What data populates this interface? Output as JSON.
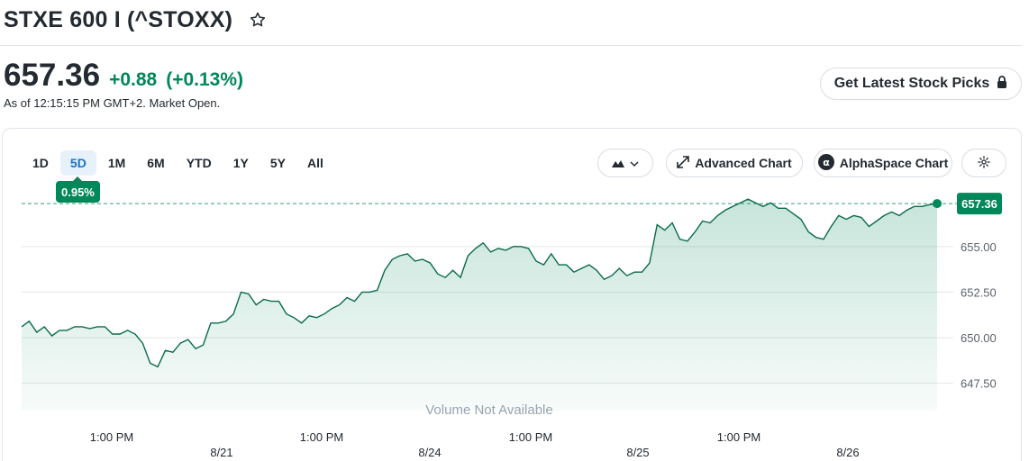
{
  "header": {
    "title": "STXE 600 I (^STOXX)"
  },
  "quote": {
    "price": "657.36",
    "change": "+0.88",
    "change_pct": "(+0.13%)",
    "as_of": "As of 12:15:15 PM GMT+2. Market Open."
  },
  "picks_button": {
    "label": "Get Latest Stock Picks"
  },
  "range_tabs": [
    {
      "label": "1D"
    },
    {
      "label": "5D"
    },
    {
      "label": "1M"
    },
    {
      "label": "6M"
    },
    {
      "label": "YTD"
    },
    {
      "label": "1Y"
    },
    {
      "label": "5Y"
    },
    {
      "label": "All"
    }
  ],
  "active_range": "5D",
  "range_change_badge": "0.95%",
  "toolbar": {
    "advanced_chart": "Advanced Chart",
    "alphaspace_chart": "AlphaSpace Chart"
  },
  "colors": {
    "positive": "#00875a",
    "active_tab": "#1a73c6",
    "text": "#232a31"
  },
  "chart_data": {
    "type": "area",
    "title": "",
    "ylim": [
      646.0,
      658.5
    ],
    "y_ticks": [
      647.5,
      650.0,
      652.5,
      655.0
    ],
    "y_tick_labels": [
      "647.50",
      "650.00",
      "652.50",
      "655.00"
    ],
    "x_time_labels": [
      "1:00 PM",
      "1:00 PM",
      "1:00 PM",
      "1:00 PM"
    ],
    "x_date_labels": [
      "8/21",
      "8/24",
      "8/25",
      "8/26"
    ],
    "last_price": 657.36,
    "last_price_label": "657.36",
    "previous_close_line": 657.36,
    "volume_note": "Volume Not Available",
    "series": [
      {
        "values": [
          650.6,
          650.9,
          650.3,
          650.6,
          650.1,
          650.4,
          650.4,
          650.6,
          650.6,
          650.5,
          650.6,
          650.6,
          650.2,
          650.2,
          650.4,
          650.2,
          649.7,
          648.6,
          648.4,
          649.3,
          649.2,
          649.7,
          649.9,
          649.4,
          649.6,
          650.8,
          650.8,
          650.9,
          651.3,
          652.5,
          652.4,
          651.8,
          652.1,
          652.0,
          652.0,
          651.3,
          651.1,
          650.8,
          651.2,
          651.1,
          651.3,
          651.6,
          651.8,
          652.2,
          652.0,
          652.5,
          652.5,
          652.6,
          653.7,
          654.3,
          654.5,
          654.6,
          654.2,
          654.3,
          654.1,
          653.5,
          653.3,
          653.7,
          653.3,
          654.5,
          654.9,
          655.2,
          654.7,
          654.9,
          654.8,
          655.0,
          655.0,
          654.9,
          654.2,
          654.0,
          654.6,
          654.0,
          654.0,
          653.6,
          653.8,
          654.0,
          653.7,
          653.2,
          653.4,
          653.8,
          653.4,
          653.6,
          653.6,
          654.1,
          656.2,
          655.9,
          656.3,
          655.4,
          655.3,
          655.8,
          656.4,
          656.3,
          656.7,
          657.0,
          657.2,
          657.4,
          657.6,
          657.4,
          657.2,
          657.4,
          657.1,
          657.1,
          656.8,
          656.5,
          655.8,
          655.5,
          655.4,
          656.1,
          656.7,
          656.5,
          656.7,
          656.6,
          656.1,
          656.4,
          656.7,
          656.9,
          656.7,
          657.0,
          657.2,
          657.2,
          657.3,
          657.36
        ]
      }
    ]
  }
}
